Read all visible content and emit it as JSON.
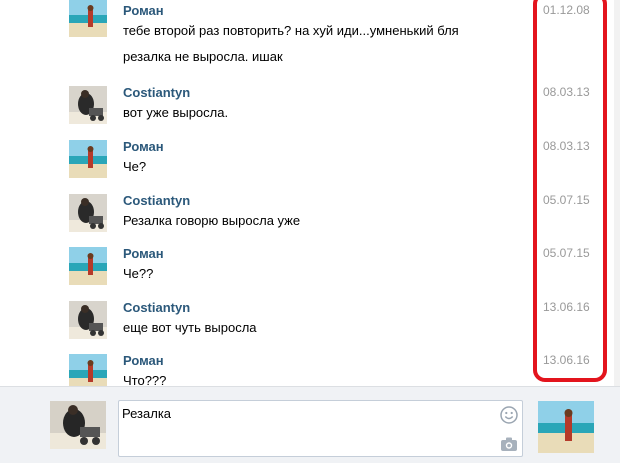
{
  "messages": [
    {
      "author": "Роман",
      "avatar": "beach-photo",
      "text": "тебе второй раз повторить? на хуй иди...умненький бля",
      "extra": "резалка не выросла. ишак",
      "date": "01.12.08"
    },
    {
      "author": "Costiantyn",
      "avatar": "person-photo",
      "text": "вот уже выросла.",
      "date": "08.03.13"
    },
    {
      "author": "Роман",
      "avatar": "beach-photo",
      "text": "Че?",
      "date": "08.03.13"
    },
    {
      "author": "Costiantyn",
      "avatar": "person-photo",
      "text": "Резалка говорю выросла уже",
      "date": "05.07.15"
    },
    {
      "author": "Роман",
      "avatar": "beach-photo",
      "text": "Че??",
      "date": "05.07.15"
    },
    {
      "author": "Costiantyn",
      "avatar": "person-photo",
      "text": "еще вот чуть выросла",
      "date": "13.06.16"
    },
    {
      "author": "Роман",
      "avatar": "beach-photo",
      "text": "Что???",
      "date": "13.06.16"
    }
  ],
  "composer": {
    "input_value": "Резалка",
    "smile_icon": "smile-icon",
    "camera_icon": "camera-icon"
  },
  "colors": {
    "author": "#2b587a",
    "date": "#999999",
    "highlight": "#e3141d",
    "composer_bg": "#f0f2f5"
  }
}
